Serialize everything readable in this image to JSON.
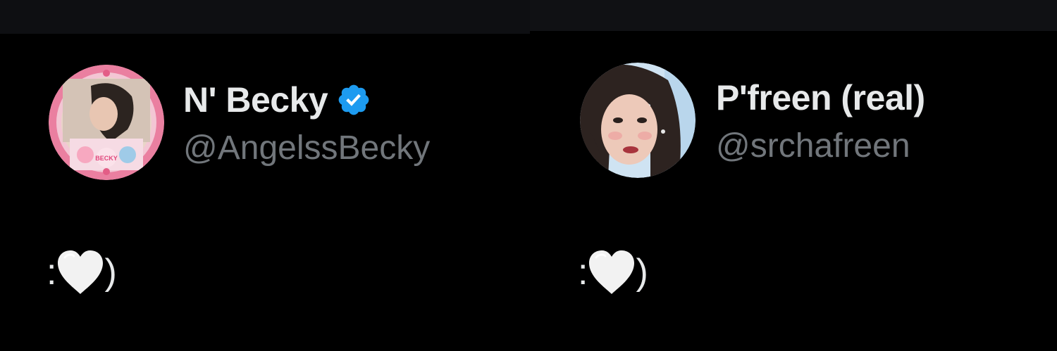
{
  "tweets": [
    {
      "display_name": "N' Becky",
      "verified": true,
      "handle": "@AngelssBecky",
      "text_prefix": ":",
      "text_suffix": ")",
      "heart_icon": "white-heart-icon",
      "avatar_icon": "profile-avatar-birthday-frame"
    },
    {
      "display_name": "P'freen (real)",
      "verified": false,
      "handle": "@srchafreen",
      "text_prefix": ":",
      "text_suffix": ")",
      "heart_icon": "white-heart-icon",
      "avatar_icon": "profile-avatar-photo"
    }
  ],
  "colors": {
    "background": "#000000",
    "name": "#e7e9ea",
    "handle": "#71767b",
    "verified": "#1d9bf0",
    "heart": "#f2f2f2"
  }
}
